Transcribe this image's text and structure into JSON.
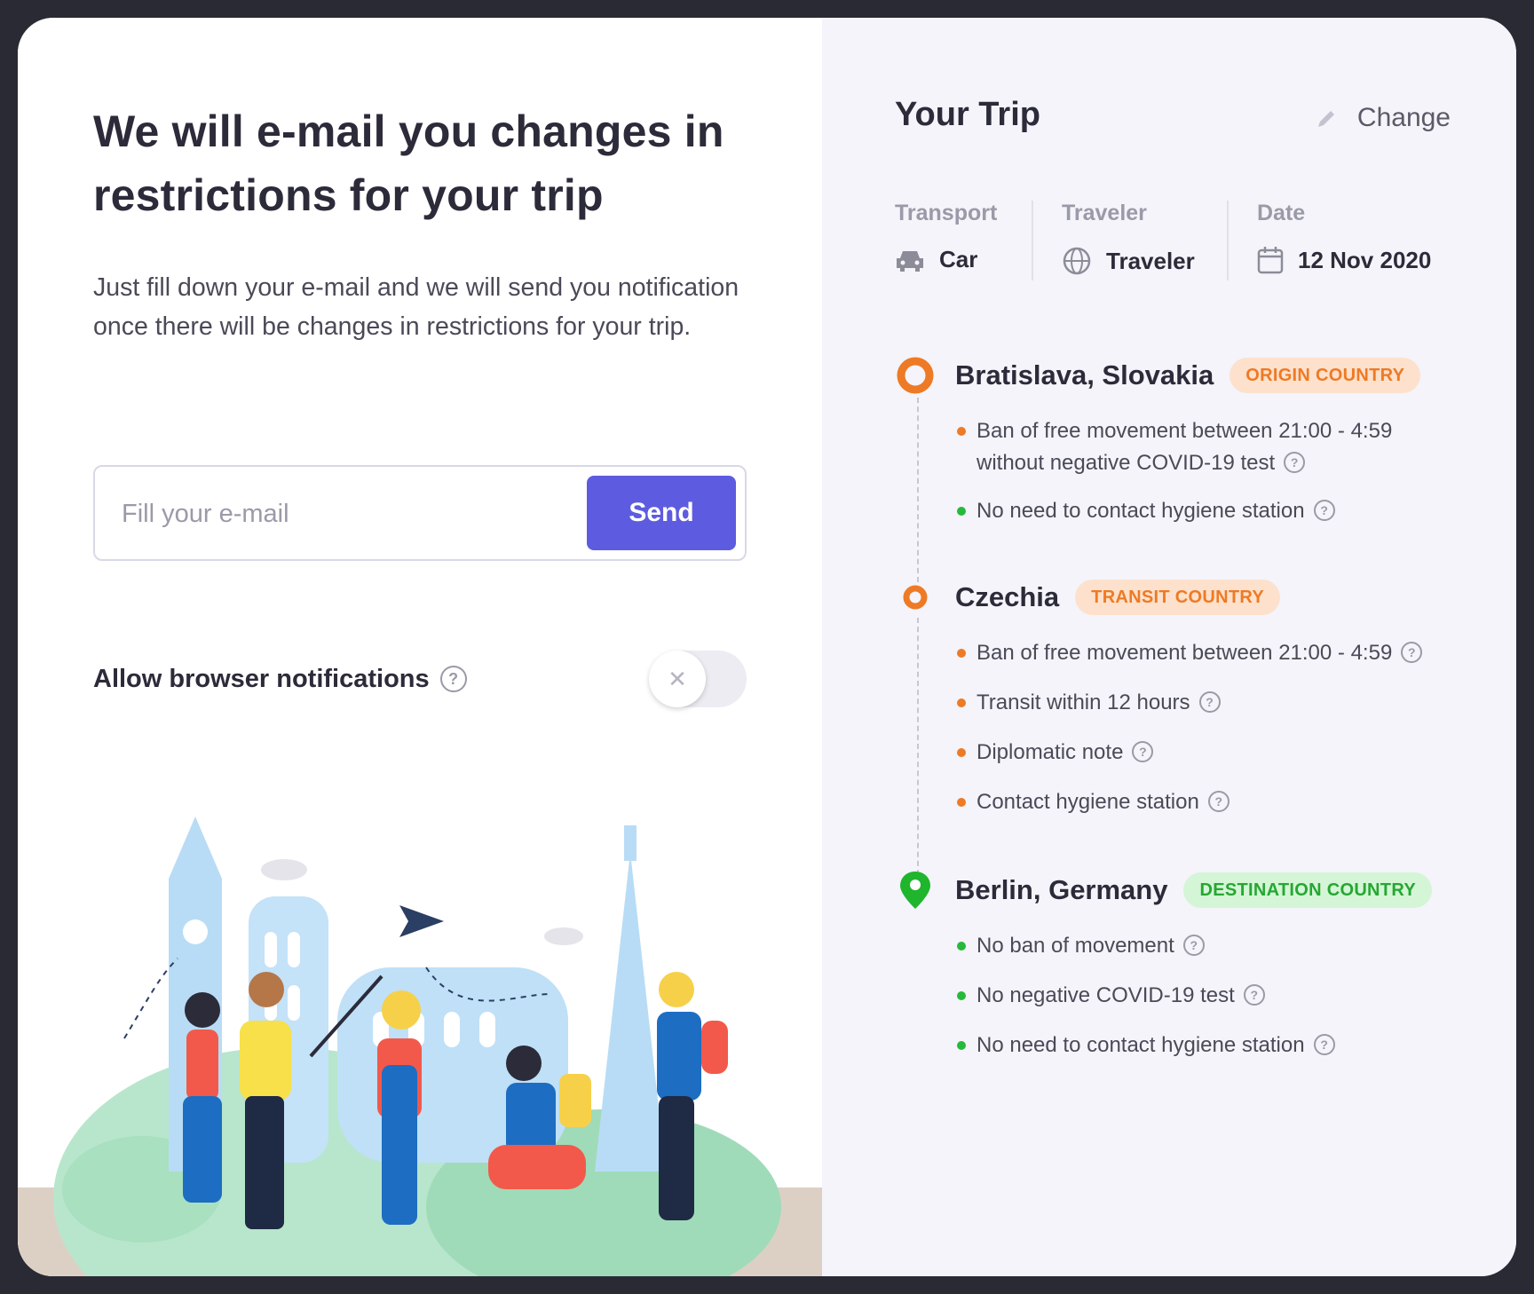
{
  "left": {
    "headline": "We will e-mail you changes in restrictions for your trip",
    "intro": "Just fill down your e-mail and we will send you notification once there will be changes in restrictions for your trip.",
    "email": {
      "placeholder": "Fill your e-mail",
      "value": ""
    },
    "send_label": "Send",
    "notifications": {
      "label": "Allow browser notifications",
      "enabled": false
    }
  },
  "trip": {
    "title": "Your Trip",
    "change_label": "Change",
    "meta": {
      "transport": {
        "label": "Transport",
        "value": "Car",
        "icon": "car-icon"
      },
      "traveler": {
        "label": "Traveler",
        "value": "Traveler",
        "icon": "globe-icon"
      },
      "date": {
        "label": "Date",
        "value": "12 Nov 2020",
        "icon": "calendar-icon"
      }
    },
    "stops": [
      {
        "name": "Bratislava, Slovakia",
        "badge": "ORIGIN COUNTRY",
        "color": "#ee7a25",
        "items": [
          {
            "text": "Ban of free movement between 21:00 - 4:59 without negative COVID-19 test",
            "status": "orange"
          },
          {
            "text": "No need to contact hygiene station",
            "status": "green"
          }
        ]
      },
      {
        "name": "Czechia",
        "badge": "TRANSIT COUNTRY",
        "color": "#ee7a25",
        "items": [
          {
            "text": "Ban of free movement between 21:00 - 4:59",
            "status": "orange"
          },
          {
            "text": "Transit within 12 hours",
            "status": "orange"
          },
          {
            "text": "Diplomatic note",
            "status": "orange"
          },
          {
            "text": "Contact hygiene station",
            "status": "orange"
          }
        ]
      },
      {
        "name": "Berlin, Germany",
        "badge": "DESTINATION COUNTRY",
        "color": "#1fb52c",
        "items": [
          {
            "text": "No ban of movement",
            "status": "green"
          },
          {
            "text": "No negative COVID-19 test",
            "status": "green"
          },
          {
            "text": "No need to contact hygiene station",
            "status": "green"
          }
        ]
      }
    ]
  },
  "colors": {
    "accent": "#5d5ce0",
    "origin": "#ee7a25",
    "destination": "#1fb52c",
    "panel_bg": "#f4f4fa"
  }
}
